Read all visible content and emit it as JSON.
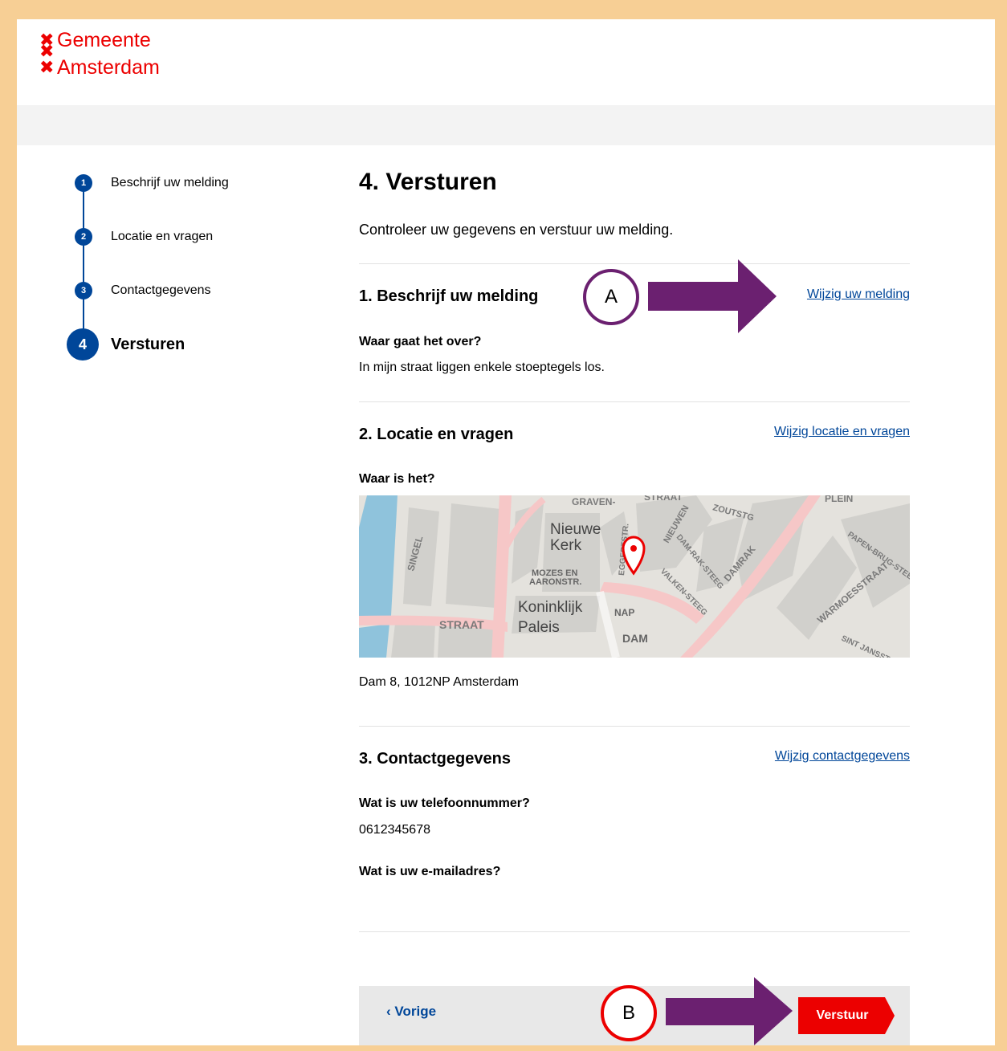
{
  "brand": {
    "line1": "Gemeente",
    "line2": "Amsterdam",
    "color": "#ec0000"
  },
  "stepper": [
    {
      "num": "1",
      "label": "Beschrijf uw melding"
    },
    {
      "num": "2",
      "label": "Locatie en vragen"
    },
    {
      "num": "3",
      "label": "Contactgegevens"
    },
    {
      "num": "4",
      "label": "Versturen"
    }
  ],
  "page": {
    "title": "4. Versturen",
    "intro": "Controleer uw gegevens en verstuur uw melding."
  },
  "sections": {
    "s1": {
      "title": "1. Beschrijf uw melding",
      "edit": "Wijzig uw melding",
      "question": "Waar gaat het over?",
      "answer": "In mijn straat liggen enkele stoeptegels los."
    },
    "s2": {
      "title": "2. Locatie en vragen",
      "edit": "Wijzig locatie en vragen",
      "question": "Waar is het?",
      "address": "Dam 8, 1012NP Amsterdam"
    },
    "s3": {
      "title": "3. Contactgegevens",
      "edit": "Wijzig contactgegevens",
      "phone_q": "Wat is uw telefoonnummer?",
      "phone_a": "0612345678",
      "email_q": "Wat is uw e-mailadres?"
    }
  },
  "map_labels": {
    "graven": "GRAVEN-",
    "straat_top": "STRAAT",
    "plein": "PLEIN",
    "singel": "SINGEL",
    "nieuwe_kerk_1": "Nieuwe",
    "nieuwe_kerk_2": "Kerk",
    "mozes_1": "MOZES EN",
    "mozes_2": "AARONSTR.",
    "koninklijk": "Koninklijk",
    "paleis": "Paleis",
    "nap": "NAP",
    "dam": "DAM",
    "damrak": "DAMRAK",
    "warmoes": "WARMOESSTRAAT",
    "zoutstg": "ZOUTSTG",
    "nieuwen": "NIEUWEN",
    "straat_left": "STRAAT",
    "damrak_steeg": "DAM-RAK-STEEG",
    "valken": "VALKEN-STEEG",
    "papen": "PAPEN-BRUG-STEEG",
    "sint": "SINT JANSST",
    "eggert": "EGGERTSTR."
  },
  "nav": {
    "prev": "Vorige",
    "submit": "Versturen"
  },
  "nav_labels": {
    "prev": "Vorige",
    "submit": "Verstuur"
  },
  "annotations": {
    "a": "A",
    "b": "B"
  },
  "colors": {
    "blue": "#004699",
    "red": "#ec0000",
    "purple": "#6b2070",
    "frame": "#f7cf95"
  }
}
